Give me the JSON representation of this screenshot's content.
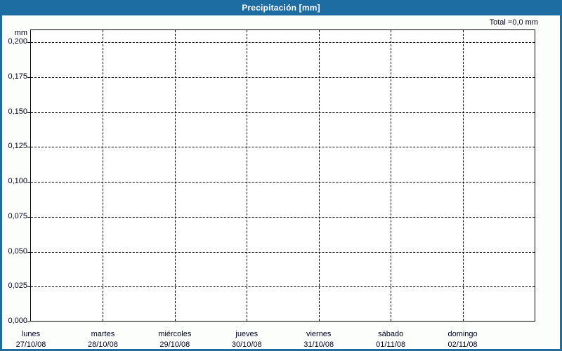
{
  "header": {
    "title": "Precipitación [mm]",
    "total_label": "Total =0,0 mm"
  },
  "chart_data": {
    "type": "bar",
    "title": "Precipitación [mm]",
    "subtitle": "Total =0,0 mm",
    "xlabel": "",
    "ylabel": "mm",
    "ylim": [
      0,
      0.209
    ],
    "grid": "dashed horizontal and vertical, black on white",
    "legend": "none",
    "y_ticks": [
      {
        "v": 0.0,
        "label": "0,000"
      },
      {
        "v": 0.025,
        "label": "0,025"
      },
      {
        "v": 0.05,
        "label": "0,050"
      },
      {
        "v": 0.075,
        "label": "0,075"
      },
      {
        "v": 0.1,
        "label": "0,100"
      },
      {
        "v": 0.125,
        "label": "0,125"
      },
      {
        "v": 0.15,
        "label": "0,150"
      },
      {
        "v": 0.175,
        "label": "0,175"
      },
      {
        "v": 0.2,
        "label": "0,200"
      }
    ],
    "categories": [
      {
        "day": "lunes",
        "date": "27/10/08"
      },
      {
        "day": "martes",
        "date": "28/10/08"
      },
      {
        "day": "miércoles",
        "date": "29/10/08"
      },
      {
        "day": "jueves",
        "date": "30/10/08"
      },
      {
        "day": "viernes",
        "date": "31/10/08"
      },
      {
        "day": "sábado",
        "date": "01/11/08"
      },
      {
        "day": "domingo",
        "date": "02/11/08"
      }
    ],
    "series": [
      {
        "name": "Precipitación",
        "values": [
          0,
          0,
          0,
          0,
          0,
          0,
          0
        ]
      }
    ],
    "total_mm": "0,0"
  },
  "colors": {
    "frame_blue": "#1D6CA2",
    "canvas_background": "#FCFEFC",
    "plot_background": "#FFFFFF",
    "grid_black": "#000000",
    "text_dark": "#000020",
    "title_white": "#FFFFFF"
  }
}
